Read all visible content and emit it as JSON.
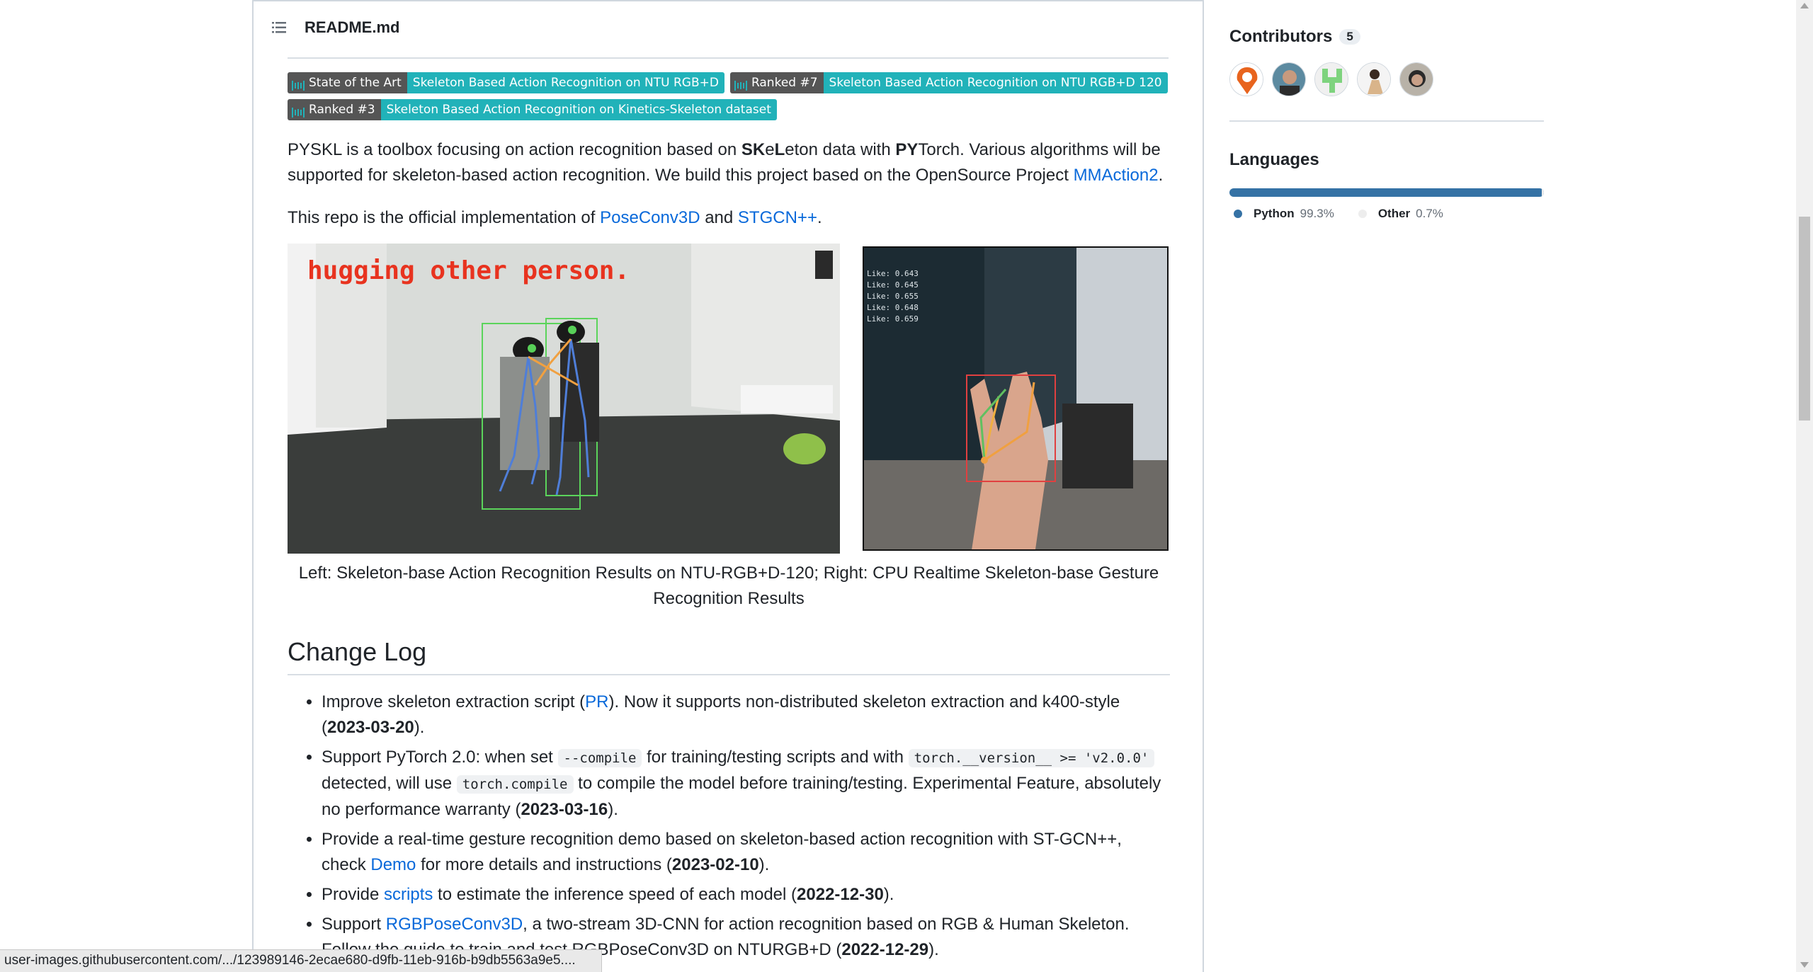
{
  "readme": {
    "title": "README.md",
    "badges": [
      {
        "left": "State of the Art",
        "right": "Skeleton Based Action Recognition on NTU RGB+D"
      },
      {
        "left": "Ranked #7",
        "right": "Skeleton Based Action Recognition on NTU RGB+D 120"
      },
      {
        "left": "Ranked #3",
        "right": "Skeleton Based Action Recognition on Kinetics-Skeleton dataset"
      }
    ],
    "intro": {
      "p1_a": "PYSKL is a toolbox focusing on action recognition based on ",
      "p1_b1": "SK",
      "p1_b2": "e",
      "p1_b3": "L",
      "p1_c": "eton data with ",
      "p1_d": "PY",
      "p1_e": "Torch. Various algorithms will be supported for skeleton-based action recognition. We build this project based on the OpenSource Project ",
      "p1_link": "MMAction2",
      "p1_end": ".",
      "p2_a": "This repo is the official implementation of ",
      "p2_link1": "PoseConv3D",
      "p2_and": " and ",
      "p2_link2": "STGCN++",
      "p2_end": "."
    },
    "figure": {
      "left_overlay_text": "hugging other person.",
      "right_overlay_lines": [
        "Like: 0.643",
        "Like: 0.645",
        "Like: 0.655",
        "Like: 0.648",
        "Like: 0.659"
      ],
      "caption": "Left: Skeleton-base Action Recognition Results on NTU-RGB+D-120; Right: CPU Realtime Skeleton-base Gesture Recognition Results"
    },
    "changelog": {
      "heading": "Change Log",
      "items": [
        {
          "a": "Improve skeleton extraction script (",
          "link": "PR",
          "b": "). Now it supports non-distributed skeleton extraction and k400-style (",
          "date": "2023-03-20",
          "c": ")."
        },
        {
          "a": "Support PyTorch 2.0: when set ",
          "code1": "--compile",
          "b": " for training/testing scripts and with ",
          "code2": "torch.__version__ >= 'v2.0.0'",
          "c": " detected, will use ",
          "code3": "torch.compile",
          "d": " to compile the model before training/testing. Experimental Feature, absolutely no performance warranty (",
          "date": "2023-03-16",
          "e": ")."
        },
        {
          "a": "Provide a real-time gesture recognition demo based on skeleton-based action recognition with ST-GCN++, check ",
          "link": "Demo",
          "b": " for more details and instructions (",
          "date": "2023-02-10",
          "c": ")."
        },
        {
          "a": "Provide ",
          "link": "scripts",
          "b": " to estimate the inference speed of each model (",
          "date": "2022-12-30",
          "c": ")."
        },
        {
          "a": "Support ",
          "link": "RGBPoseConv3D",
          "b": ", a two-stream 3D-CNN for action recognition based on RGB & Human Skeleton. Follow the guide to train and test RGBPoseConv3D on NTURGB+D (",
          "date": "2022-12-29",
          "c": ")."
        }
      ]
    }
  },
  "sidebar": {
    "contributors": {
      "title": "Contributors",
      "count": "5"
    },
    "languages": {
      "title": "Languages",
      "items": [
        {
          "name": "Python",
          "pct": "99.3%",
          "color": "#3572A5"
        },
        {
          "name": "Other",
          "pct": "0.7%",
          "color": "#EDEDED"
        }
      ]
    }
  },
  "statusbar": {
    "url": "user-images.githubusercontent.com/.../123989146-2ecae680-d9fb-11eb-916b-b9db5563a9e5...."
  }
}
